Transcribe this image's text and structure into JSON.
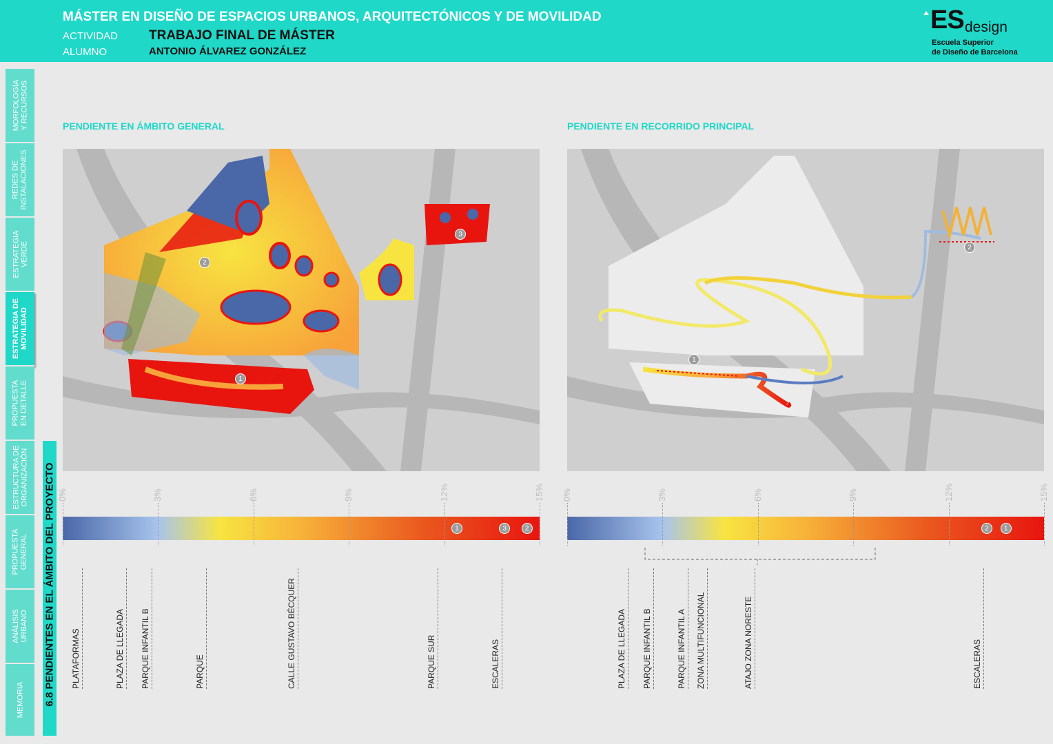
{
  "header": {
    "title": "MÁSTER EN DISEÑO DE ESPACIOS URBANOS, ARQUITECTÓNICOS Y DE MOVILIDAD",
    "activity_label": "ACTIVIDAD",
    "activity_value": "TRABAJO FINAL DE MÁSTER",
    "student_label": "ALUMNO",
    "student_value": "ANTONIO ÁLVAREZ GONZÁLEZ",
    "logo_es": "ES",
    "logo_design": "design",
    "logo_line1": "Escuela Superior",
    "logo_line2": "de Diseño de Barcelona"
  },
  "nav": [
    {
      "label": "MORFOLOGÍA\nY RECURSOS",
      "active": false
    },
    {
      "label": "REDES DE\nINSTALACIONES",
      "active": false
    },
    {
      "label": "ESTRATEGIA\nVERDE",
      "active": false
    },
    {
      "label": "ESTRATEGIA DE\nMOVILIDAD",
      "active": true
    },
    {
      "label": "PROPUESTA\nEN DETALLE",
      "active": false
    },
    {
      "label": "ESTRUCTURA DE\nORGANIZACIÓN",
      "active": false
    },
    {
      "label": "PROPUESTA\nGENERAL",
      "active": false
    },
    {
      "label": "ANÁLISIS\nURBANO",
      "active": false
    },
    {
      "label": "MEMORIA",
      "active": false
    }
  ],
  "section_title": "6.8 PENDIENTES EN EL ÁMBITO DEL PROYECTO",
  "colors": {
    "accent": "#1fd8c8",
    "low": "#4a67a8",
    "mid": "#f7e441",
    "high": "#e8150f"
  },
  "scale_ticks": [
    "0%",
    "3%",
    "6%",
    "9%",
    "12%",
    "15%"
  ],
  "panels": [
    {
      "title": "PENDIENTE EN ÁMBITO GENERAL",
      "map_markers": [
        "1",
        "2",
        "3"
      ],
      "scale_markers": [
        {
          "label": "1",
          "value": 12.4
        },
        {
          "label": "3",
          "value": 13.9
        },
        {
          "label": "2",
          "value": 14.6
        }
      ],
      "categories": [
        {
          "label": "PLATAFORMAS",
          "value": 0.6
        },
        {
          "label": "PLAZA DE LLEGADA",
          "value": 2.0
        },
        {
          "label": "PARQUE INFANTIL B",
          "value": 2.8
        },
        {
          "label": "PARQUE",
          "value": 4.5
        },
        {
          "label": "CALLE GUSTAVO BÉCQUER",
          "value": 7.4
        },
        {
          "label": "PARQUE SUR",
          "value": 11.8
        },
        {
          "label": "ESCALERAS",
          "value": 13.8
        }
      ]
    },
    {
      "title": "PENDIENTE EN RECORRIDO PRINCIPAL",
      "map_markers": [
        "1",
        "2"
      ],
      "scale_markers": [
        {
          "label": "2",
          "value": 13.2
        },
        {
          "label": "1",
          "value": 13.8
        }
      ],
      "categories": [
        {
          "label": "PLAZA DE LLEGADA",
          "value": 1.9
        },
        {
          "label": "PARQUE INFANTIL B",
          "value": 2.7
        },
        {
          "label": "PARQUE INFANTIL A",
          "value": 3.8
        },
        {
          "label": "ZONA MULTIFUNCIONAL",
          "value": 4.4
        },
        {
          "label": "ATAJO ZONA NORESTE",
          "value": 5.9
        },
        {
          "label": "ESCALERAS",
          "value": 13.1
        }
      ]
    }
  ]
}
